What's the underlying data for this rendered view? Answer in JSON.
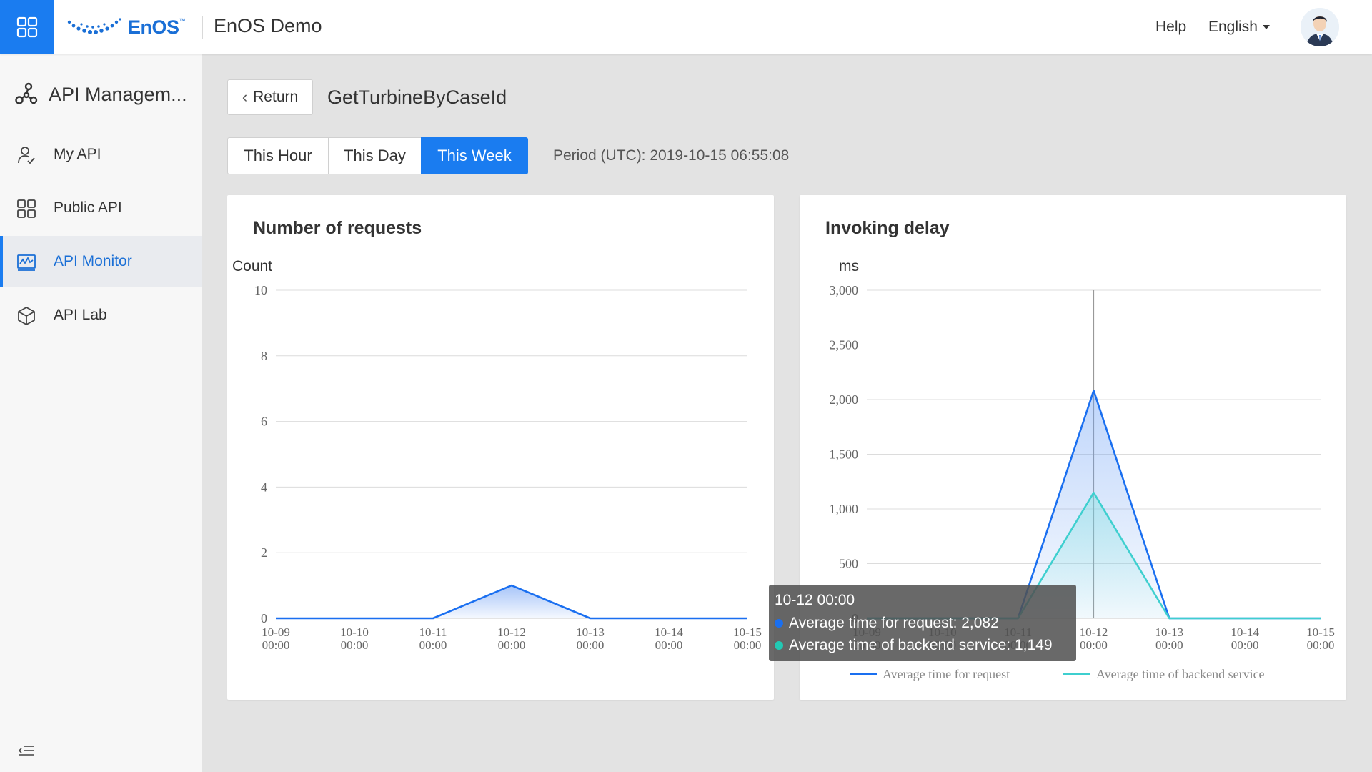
{
  "header": {
    "brand": "EnOS",
    "brand_tm": "™",
    "org_name": "EnOS Demo",
    "help": "Help",
    "language": "English"
  },
  "sidebar": {
    "title": "API Managem...",
    "items": [
      {
        "label": "My API",
        "icon": "user-check-icon"
      },
      {
        "label": "Public API",
        "icon": "apps-grid-icon"
      },
      {
        "label": "API Monitor",
        "icon": "monitor-pulse-icon",
        "active": true
      },
      {
        "label": "API Lab",
        "icon": "cube-icon"
      }
    ]
  },
  "main": {
    "return_label": "Return",
    "api_name": "GetTurbineByCaseId",
    "tabs": [
      {
        "label": "This Hour"
      },
      {
        "label": "This Day"
      },
      {
        "label": "This Week",
        "active": true
      }
    ],
    "period": "Period (UTC): 2019-10-15 06:55:08"
  },
  "colors": {
    "accent": "#1a7cf0",
    "series_request": "#1a6ff0",
    "series_backend": "#3ecfcf"
  },
  "chart_data": [
    {
      "type": "area",
      "title": "Number of requests",
      "ylabel": "Count",
      "categories": [
        "10-09 00:00",
        "10-10 00:00",
        "10-11 00:00",
        "10-12 00:00",
        "10-13 00:00",
        "10-14 00:00",
        "10-15 00:00"
      ],
      "yticks": [
        "10",
        "8",
        "6",
        "4",
        "2",
        "0"
      ],
      "ylim": [
        0,
        10
      ],
      "series": [
        {
          "values": [
            0,
            0,
            0,
            1,
            0,
            0,
            0
          ]
        }
      ]
    },
    {
      "type": "area",
      "title": "Invoking delay",
      "ylabel": "ms",
      "categories": [
        "10-09 00:00",
        "10-10 00:00",
        "10-11 00:00",
        "10-12 00:00",
        "10-13 00:00",
        "10-14 00:00",
        "10-15 00:00"
      ],
      "yticks": [
        "3,000",
        "2,500",
        "2,000",
        "1,500",
        "1,000",
        "500",
        "0"
      ],
      "ylim": [
        0,
        3000
      ],
      "legend_position": "bottom",
      "series": [
        {
          "name": "Average time for request",
          "values": [
            0,
            0,
            0,
            2082,
            0,
            0,
            0
          ]
        },
        {
          "name": "Average time of backend service",
          "values": [
            0,
            0,
            0,
            1149,
            0,
            0,
            0
          ]
        }
      ],
      "tooltip": {
        "title": "10-12 00:00",
        "rows": [
          "Average time for request: 2,082",
          "Average time of backend service: 1,149"
        ]
      }
    }
  ]
}
